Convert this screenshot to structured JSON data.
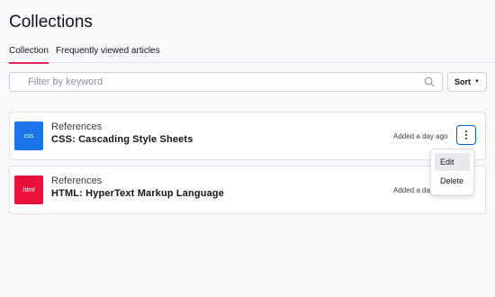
{
  "header": {
    "title": "Collections"
  },
  "tabs": [
    {
      "label": "Collection",
      "active": true
    },
    {
      "label": "Frequently viewed articles",
      "active": false
    }
  ],
  "search": {
    "placeholder": "Filter by keyword",
    "value": "",
    "icon": "search-icon"
  },
  "sort": {
    "label": "Sort",
    "icon": "caret-down-icon"
  },
  "items": [
    {
      "thumb_label": "css",
      "thumb_color": "#1a73e8",
      "category": "References",
      "title": "CSS: Cascading Style Sheets",
      "added": "Added a day ago"
    },
    {
      "thumb_label": "html",
      "thumb_color": "#e8103a",
      "category": "References",
      "title": "HTML: HyperText Markup Language",
      "added": "Added a day ago"
    }
  ],
  "item_menu": {
    "open_on_item": 0,
    "items": [
      {
        "label": "Edit",
        "highlighted": true
      },
      {
        "label": "Delete",
        "highlighted": false
      }
    ]
  },
  "colors": {
    "accent": "#e22850",
    "focus": "#0060df"
  }
}
